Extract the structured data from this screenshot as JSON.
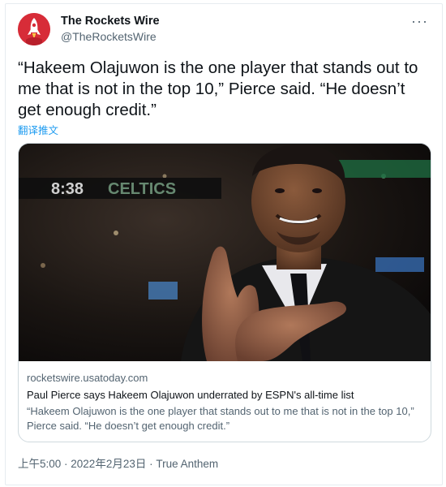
{
  "author": {
    "name": "The Rockets Wire",
    "handle": "@TheRocketsWire",
    "avatar_icon": "rocket-icon",
    "avatar_color": "#d72c38"
  },
  "tweet": {
    "text": "“Hakeem Olajuwon is the one player that stands out to me that is not in the top 10,” Pierce said. “He doesn’t get enough credit.”",
    "translate_label": "翻译推文"
  },
  "card": {
    "image_caption": "",
    "domain": "rocketswire.usatoday.com",
    "title": "Paul Pierce says Hakeem Olajuwon underrated by ESPN's all-time list",
    "description": "“Hakeem Olajuwon is the one player that stands out to me that is not in the top 10,” Pierce said. “He doesn’t get enough credit.”"
  },
  "meta": {
    "time": "上午5:00",
    "separator": " · ",
    "date": "2022年2月23日",
    "source": "True Anthem"
  },
  "menu": {
    "more_label": "···"
  },
  "colors": {
    "link": "#1d9bf0",
    "secondary_text": "#536471",
    "border": "#cfd9de"
  }
}
